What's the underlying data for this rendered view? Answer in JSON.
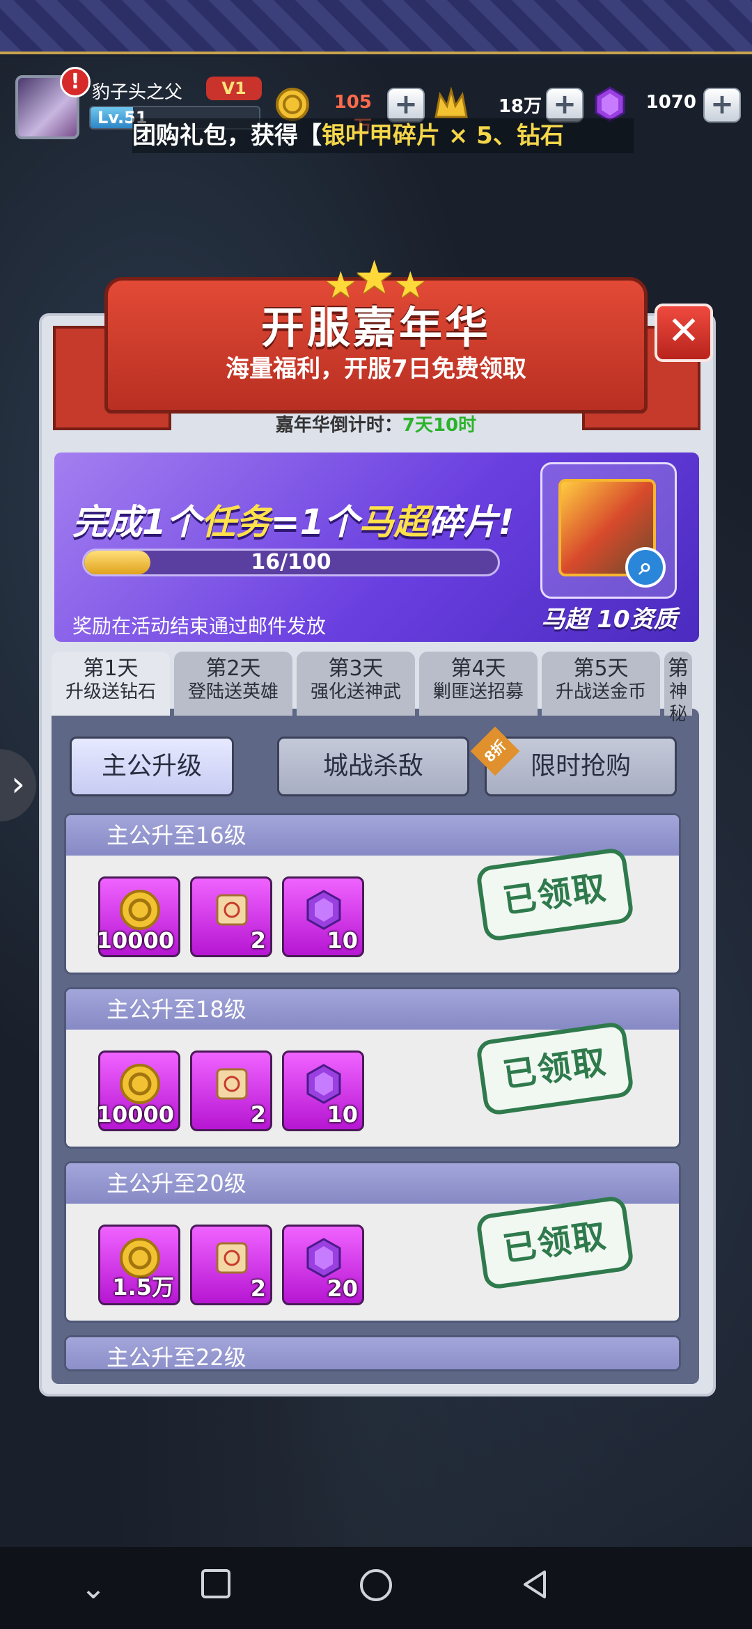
{
  "player": {
    "name": "豹子头之父",
    "vip_level": "1",
    "level_label": "Lv.51",
    "level_progress": 0.25
  },
  "resources": {
    "gold": "105万",
    "stamina": "18万",
    "gems": "1070"
  },
  "marquee": {
    "prefix": "团购礼包，获得【",
    "highlight": "银叶甲碎片 × 5、钻石"
  },
  "event": {
    "title": "开服嘉年华",
    "subtitle": "海量福利，开服7日免费领取",
    "countdown_label": "嘉年华倒计时：",
    "countdown_value": "7天10时"
  },
  "promo": {
    "title_part1": "完成1个",
    "title_task": "任务",
    "title_part2": "=1个",
    "title_hero": "马超",
    "title_part3": "碎片!",
    "progress_text": "16/100",
    "progress_current": 16,
    "progress_max": 100,
    "note": "奖励在活动结束通过邮件发放",
    "hero_label": "马超 10资质"
  },
  "day_tabs": [
    {
      "day": "第1天",
      "desc": "升级送钻石"
    },
    {
      "day": "第2天",
      "desc": "登陆送英雄"
    },
    {
      "day": "第3天",
      "desc": "强化送神武"
    },
    {
      "day": "第4天",
      "desc": "剿匪送招募"
    },
    {
      "day": "第5天",
      "desc": "升战送金币"
    },
    {
      "day": "第",
      "desc": "神秘"
    }
  ],
  "categories": [
    {
      "label": "主公升级"
    },
    {
      "label": "城战杀敌"
    },
    {
      "label": "限时抢购",
      "tag": "8折"
    }
  ],
  "rewards": [
    {
      "title": "主公升至16级",
      "items": [
        "10000",
        "2",
        "10"
      ],
      "status": "已领取"
    },
    {
      "title": "主公升至18级",
      "items": [
        "10000",
        "2",
        "10"
      ],
      "status": "已领取"
    },
    {
      "title": "主公升至20级",
      "items": [
        "1.5万",
        "2",
        "20"
      ],
      "status": "已领取"
    },
    {
      "title": "主公升至22级"
    }
  ],
  "icons": {
    "gold": "gold-coin-icon",
    "scroll": "recruit-scroll-icon",
    "gem": "purple-gem-icon"
  },
  "colors": {
    "accent_red": "#c53a2b",
    "promo_purple": "#6a3fe0",
    "claimed_green": "#2f7a4c"
  }
}
